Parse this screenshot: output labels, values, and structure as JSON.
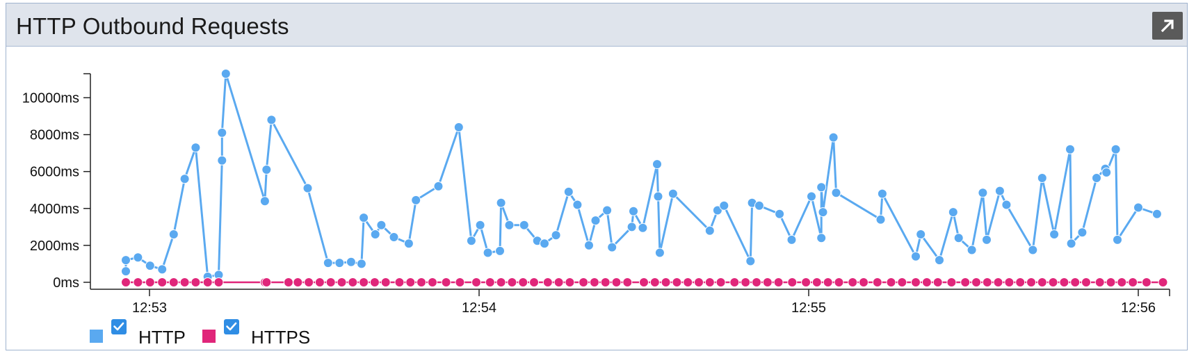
{
  "panel": {
    "title": "HTTP Outbound Requests"
  },
  "icons": {
    "expand": "expand-arrow-icon",
    "checkbox": "checkbox-checked-icon"
  },
  "colors": {
    "http": "#5aa9f0",
    "https": "#e0267a",
    "header_bg": "#dfe4ec",
    "button_bg": "#5a5a5a",
    "checkbox": "#2f8de4"
  },
  "chart_data": {
    "type": "line",
    "y_tick_labels": [
      "0ms",
      "2000ms",
      "4000ms",
      "6000ms",
      "8000ms",
      "10000ms"
    ],
    "y_ticks": [
      0,
      2000,
      4000,
      6000,
      8000,
      10000
    ],
    "ylim": [
      0,
      11300
    ],
    "x_tick_labels": [
      "12:53",
      "12:54",
      "12:55",
      "12:56"
    ],
    "x_tick_seconds": [
      0,
      60,
      120,
      180
    ],
    "xlim_seconds": [
      -4.3,
      184.5
    ],
    "x_unit": "seconds after 12:53",
    "grid": false,
    "legend_position": "bottom-left",
    "series": [
      {
        "name": "HTTP",
        "points": [
          [
            -4.3,
            600
          ],
          [
            -4.3,
            1200
          ],
          [
            -2.1,
            1350
          ],
          [
            0.1,
            900
          ],
          [
            2.3,
            700
          ],
          [
            4.4,
            2600
          ],
          [
            6.4,
            5600
          ],
          [
            8.4,
            7300
          ],
          [
            10.6,
            300
          ],
          [
            12.6,
            400
          ],
          [
            13.2,
            6600
          ],
          [
            13.2,
            8100
          ],
          [
            13.9,
            11300
          ],
          [
            21.0,
            4400
          ],
          [
            21.3,
            6100
          ],
          [
            22.2,
            8800
          ],
          [
            28.8,
            5100
          ],
          [
            32.5,
            1050
          ],
          [
            34.6,
            1050
          ],
          [
            36.7,
            1100
          ],
          [
            38.6,
            1000
          ],
          [
            39.0,
            3500
          ],
          [
            41.1,
            2600
          ],
          [
            42.2,
            3100
          ],
          [
            44.5,
            2450
          ],
          [
            47.2,
            2100
          ],
          [
            48.5,
            4450
          ],
          [
            52.6,
            5200
          ],
          [
            56.3,
            8400
          ],
          [
            58.6,
            2250
          ],
          [
            60.2,
            3100
          ],
          [
            61.6,
            1600
          ],
          [
            63.8,
            1700
          ],
          [
            64.0,
            4300
          ],
          [
            65.5,
            3100
          ],
          [
            68.2,
            3100
          ],
          [
            70.6,
            2250
          ],
          [
            71.9,
            2100
          ],
          [
            74.0,
            2550
          ],
          [
            76.3,
            4900
          ],
          [
            77.9,
            4200
          ],
          [
            80.0,
            2000
          ],
          [
            81.2,
            3350
          ],
          [
            83.3,
            3900
          ],
          [
            84.2,
            1900
          ],
          [
            87.8,
            3000
          ],
          [
            88.1,
            3850
          ],
          [
            89.8,
            2950
          ],
          [
            92.4,
            6400
          ],
          [
            92.6,
            4650
          ],
          [
            92.9,
            1600
          ],
          [
            95.3,
            4800
          ],
          [
            102.0,
            2800
          ],
          [
            103.4,
            3900
          ],
          [
            104.6,
            4150
          ],
          [
            109.4,
            1150
          ],
          [
            109.7,
            4300
          ],
          [
            111.0,
            4150
          ],
          [
            114.7,
            3700
          ],
          [
            116.9,
            2300
          ],
          [
            120.5,
            4650
          ],
          [
            122.3,
            2400
          ],
          [
            122.3,
            5150
          ],
          [
            122.6,
            3800
          ],
          [
            124.5,
            7850
          ],
          [
            125.0,
            4850
          ],
          [
            133.1,
            3400
          ],
          [
            133.4,
            4800
          ],
          [
            139.5,
            1400
          ],
          [
            140.4,
            2600
          ],
          [
            143.8,
            1200
          ],
          [
            146.3,
            3800
          ],
          [
            147.3,
            2400
          ],
          [
            149.7,
            1750
          ],
          [
            151.7,
            4850
          ],
          [
            152.4,
            2300
          ],
          [
            154.8,
            4950
          ],
          [
            156.0,
            4200
          ],
          [
            160.8,
            1750
          ],
          [
            162.5,
            5650
          ],
          [
            164.7,
            2600
          ],
          [
            167.6,
            7200
          ],
          [
            167.8,
            2100
          ],
          [
            169.8,
            2700
          ],
          [
            172.4,
            5650
          ],
          [
            174.0,
            6150
          ],
          [
            174.2,
            5950
          ],
          [
            175.9,
            7200
          ],
          [
            176.2,
            2300
          ],
          [
            180.0,
            4050
          ],
          [
            183.4,
            3700
          ]
        ]
      },
      {
        "name": "HTTPS",
        "points": [
          [
            -4.3,
            0
          ],
          [
            -2.1,
            0
          ],
          [
            0.1,
            0
          ],
          [
            2.3,
            0
          ],
          [
            4.4,
            0
          ],
          [
            6.4,
            0
          ],
          [
            8.4,
            0
          ],
          [
            10.6,
            0
          ],
          [
            12.6,
            0
          ],
          [
            21.0,
            0
          ],
          [
            21.3,
            0
          ],
          [
            25.3,
            0
          ],
          [
            27.0,
            0
          ],
          [
            29.0,
            0
          ],
          [
            31.0,
            0
          ],
          [
            33.0,
            0
          ],
          [
            35.0,
            0
          ],
          [
            37.0,
            0
          ],
          [
            39.0,
            0
          ],
          [
            41.0,
            0
          ],
          [
            43.0,
            0
          ],
          [
            45.5,
            0
          ],
          [
            47.5,
            0
          ],
          [
            49.5,
            0
          ],
          [
            51.5,
            0
          ],
          [
            54.0,
            0
          ],
          [
            56.5,
            0
          ],
          [
            59.5,
            0
          ],
          [
            62.0,
            0
          ],
          [
            64.0,
            0
          ],
          [
            66.0,
            0
          ],
          [
            68.0,
            0
          ],
          [
            70.0,
            0
          ],
          [
            72.5,
            0
          ],
          [
            74.5,
            0
          ],
          [
            76.5,
            0
          ],
          [
            79.0,
            0
          ],
          [
            81.0,
            0
          ],
          [
            83.0,
            0
          ],
          [
            85.0,
            0
          ],
          [
            87.0,
            0
          ],
          [
            90.0,
            0
          ],
          [
            92.0,
            0
          ],
          [
            94.0,
            0
          ],
          [
            96.0,
            0
          ],
          [
            98.0,
            0
          ],
          [
            100.0,
            0
          ],
          [
            102.0,
            0
          ],
          [
            104.0,
            0
          ],
          [
            106.5,
            0
          ],
          [
            108.5,
            0
          ],
          [
            110.5,
            0
          ],
          [
            112.5,
            0
          ],
          [
            114.5,
            0
          ],
          [
            117.0,
            0
          ],
          [
            119.5,
            0
          ],
          [
            121.5,
            0
          ],
          [
            123.5,
            0
          ],
          [
            125.5,
            0
          ],
          [
            128.0,
            0
          ],
          [
            130.0,
            0
          ],
          [
            132.5,
            0
          ],
          [
            135.0,
            0
          ],
          [
            137.0,
            0
          ],
          [
            139.5,
            0
          ],
          [
            141.5,
            0
          ],
          [
            143.5,
            0
          ],
          [
            146.0,
            0
          ],
          [
            148.5,
            0
          ],
          [
            150.5,
            0
          ],
          [
            152.5,
            0
          ],
          [
            154.5,
            0
          ],
          [
            156.5,
            0
          ],
          [
            158.5,
            0
          ],
          [
            160.5,
            0
          ],
          [
            162.5,
            0
          ],
          [
            164.5,
            0
          ],
          [
            166.5,
            0
          ],
          [
            168.5,
            0
          ],
          [
            170.5,
            0
          ],
          [
            173.0,
            0
          ],
          [
            175.0,
            0
          ],
          [
            177.0,
            0
          ],
          [
            179.0,
            0
          ],
          [
            181.5,
            0
          ],
          [
            184.5,
            0
          ]
        ]
      }
    ],
    "legend": [
      {
        "name": "HTTP",
        "checked": true
      },
      {
        "name": "HTTPS",
        "checked": true
      }
    ]
  }
}
